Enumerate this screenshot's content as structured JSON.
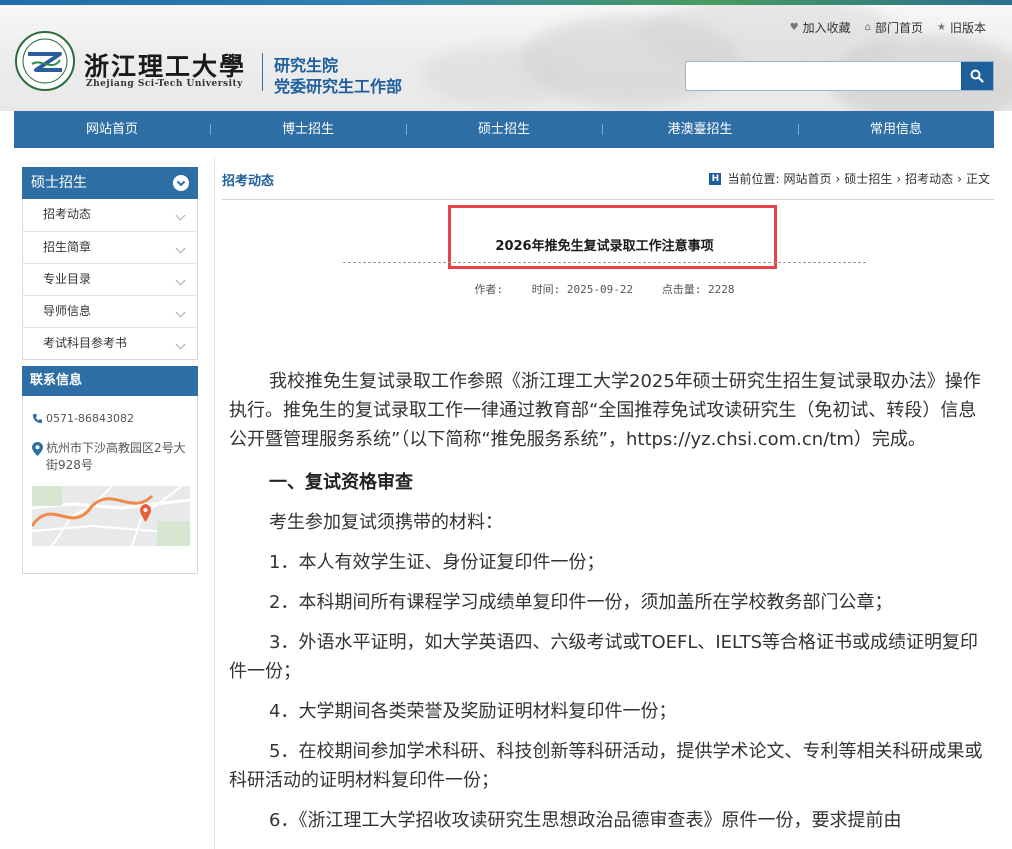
{
  "header": {
    "uni_name": "浙江理工大學",
    "uni_en": "Zhejiang Sci-Tech University",
    "dept_line1": "研究生院",
    "dept_line2": "党委研究生工作部",
    "toplinks": [
      "加入收藏",
      "部门首页",
      "旧版本"
    ],
    "search_placeholder": ""
  },
  "nav": [
    "网站首页",
    "博士招生",
    "硕士招生",
    "港澳臺招生",
    "常用信息"
  ],
  "sidebar": {
    "title": "硕士招生",
    "items": [
      "招考动态",
      "招生简章",
      "专业目录",
      "导师信息",
      "考试科目参考书"
    ]
  },
  "contact": {
    "title": "联系信息",
    "phone": "0571-86843082",
    "address": "杭州市下沙高教园区2号大街928号"
  },
  "breadcrumb": {
    "section": "招考动态",
    "label": "当前位置:",
    "items": [
      "网站首页",
      "硕士招生",
      "招考动态",
      "正文"
    ]
  },
  "article": {
    "title": "2026年推免生复试录取工作注意事项",
    "author": "作者:",
    "time": "时间: 2025-09-22",
    "hits": "点击量: 2228",
    "paragraphs": [
      "我校推免生复试录取工作参照《浙江理工大学2025年硕士研究生招生复试录取办法》操作执行。推免生的复试录取工作一律通过教育部“全国推荐免试攻读研究生（免初试、转段）信息公开暨管理服务系统”（以下简称“推免服务系统”，https://yz.chsi.com.cn/tm）完成。",
      "一、复试资格审查",
      "考生参加复试须携带的材料：",
      "1．本人有效学生证、身份证复印件一份；",
      "2．本科期间所有课程学习成绩单复印件一份，须加盖所在学校教务部门公章；",
      "3．外语水平证明，如大学英语四、六级考试或TOEFL、IELTS等合格证书或成绩证明复印件一份；",
      "4．大学期间各类荣誉及奖励证明材料复印件一份；",
      "5．在校期间参加学术科研、科技创新等科研活动，提供学术论文、专利等相关科研成果或科研活动的证明材料复印件一份；",
      "6．《浙江理工大学招收攻读研究生思想政治品德审查表》原件一份，要求提前由"
    ]
  },
  "colors": {
    "primary": "#2d6ea4",
    "link": "#1f5e9c",
    "highlight": "#e8424a"
  }
}
